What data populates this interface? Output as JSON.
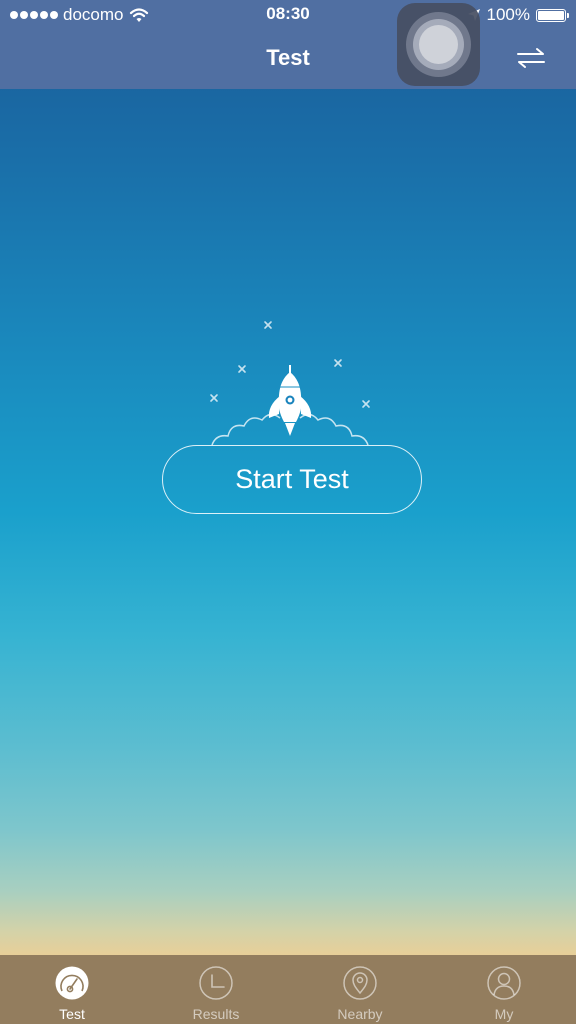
{
  "status_bar": {
    "carrier": "docomo",
    "time": "08:30",
    "battery": "100%",
    "icons": [
      "signal-dots-icon",
      "wifi-icon",
      "location-arrow-icon",
      "battery-icon"
    ]
  },
  "nav": {
    "title": "Test",
    "right_icon": "swap-arrows-icon"
  },
  "main": {
    "start_button_label": "Start Test",
    "illustration": "rocket-icon"
  },
  "tabbar": {
    "tabs": [
      {
        "label": "Test",
        "icon": "speedometer-icon",
        "active": true
      },
      {
        "label": "Results",
        "icon": "clock-icon",
        "active": false
      },
      {
        "label": "Nearby",
        "icon": "map-pin-icon",
        "active": false
      },
      {
        "label": "My",
        "icon": "user-icon",
        "active": false
      }
    ]
  },
  "colors": {
    "header_bg": "#506fa2",
    "tabbar_bg": "#937d5e",
    "gradient_top": "#1a5c98",
    "gradient_middle": "#1aa0cc",
    "gradient_bottom": "#e8cf98"
  }
}
